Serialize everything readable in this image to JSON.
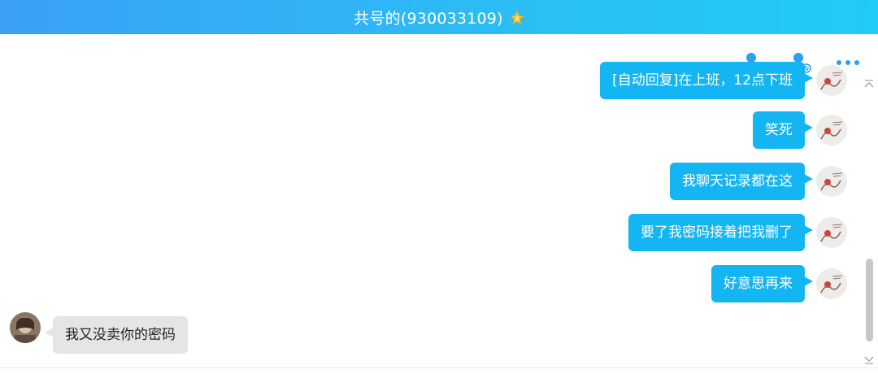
{
  "header": {
    "title": "共号的(930033109)",
    "star_icon": "star-badge-icon",
    "gradient": [
      "#3aa0f7",
      "#20cbf8"
    ]
  },
  "toolbar": {
    "items": [
      {
        "icon": "add-friend-icon"
      },
      {
        "icon": "block-friend-icon"
      },
      {
        "icon": "more-options-icon"
      }
    ]
  },
  "colors": {
    "my_bubble": "#13b6f2",
    "their_bubble": "#e5e5e5",
    "accent": "#2b9ff5"
  },
  "messages": [
    {
      "sender": "me",
      "text": "[自动回复]在上班，12点下班"
    },
    {
      "sender": "me",
      "text": "笑死"
    },
    {
      "sender": "me",
      "text": "我聊天记录都在这"
    },
    {
      "sender": "me",
      "text": "要了我密码接着把我删了"
    },
    {
      "sender": "me",
      "text": "好意思再来"
    },
    {
      "sender": "them",
      "text": "我又没卖你的密码"
    }
  ]
}
